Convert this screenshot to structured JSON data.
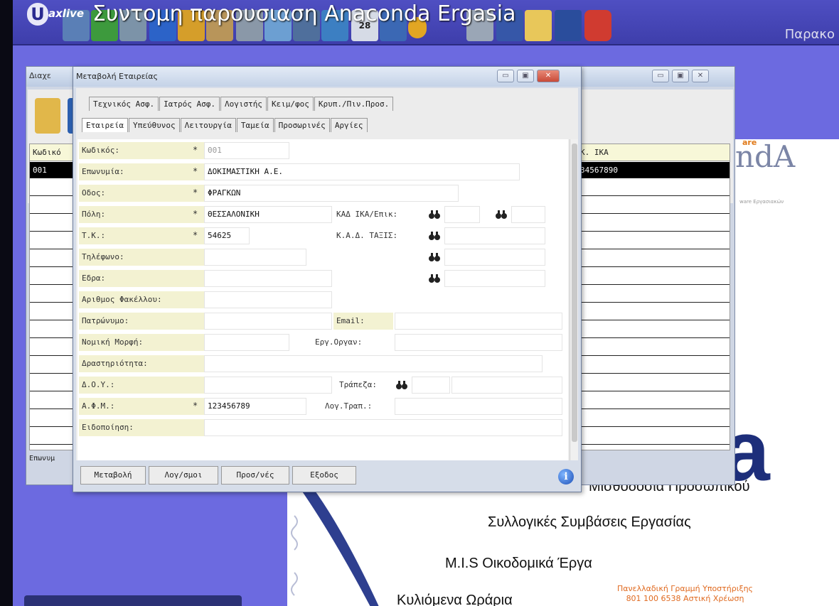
{
  "video": {
    "title": "Συντομη παρουσιαση Anaconda Ergasia",
    "brand": "axlive",
    "brand_initial": "U",
    "right_link": "Παρακο"
  },
  "toolbar": {
    "icons": [
      "tool-icon",
      "check-icon",
      "folder-icon",
      "sigma-icon",
      "bell-icon",
      "pyramid-icon",
      "clock-icon",
      "chart-icon",
      "phone-icon",
      "globe-icon",
      "calendar-icon",
      "chart-up-icon",
      "coin-icon",
      "database-icon",
      "user-icon",
      "notepad-icon",
      "person-icon",
      "power-icon"
    ],
    "calendar_day": "28"
  },
  "bg_window": {
    "title": "Διαχε",
    "columns": [
      "Κωδικό",
      "Κ. ΙΚΑ"
    ],
    "selected_row": {
      "code": "001",
      "ika": "34567890"
    },
    "bottom_label": "Επωνυμ"
  },
  "dialog": {
    "title": "Μεταβολή Εταιρείας",
    "tabs_row1": [
      "Τεχνικός Ασφ.",
      "Ιατρός Ασφ.",
      "Λογιστής",
      "Κειμ/φος",
      "Κρυπ./Πιν.Προσ."
    ],
    "tabs_row2": [
      "Εταιρεία",
      "Υπεύθυνος",
      "Λειτουργία",
      "Ταμεία",
      "Προσωρινές",
      "Αργίες"
    ],
    "fields": {
      "code_label": "Κωδικός:",
      "code_value": "001",
      "name_label": "Επωνυμία:",
      "name_value": "ΔΟΚΙΜΑΣΤΙΚΗ Α.Ε.",
      "street_label": "Οδος:",
      "street_value": "ΦΡΑΓΚΩΝ",
      "city_label": "Πόλη:",
      "city_value": "ΘΕΣΣΑΛΟΝΙΚΗ",
      "kad_ika_label": "ΚΑΔ ΙΚΑ/Επικ:",
      "tk_label": "Τ.Κ.:",
      "tk_value": "54625",
      "kad_taxis_label": "Κ.Α.Δ. ΤΑΞΙΣ:",
      "phone_label": "Τηλέφωνο:",
      "seat_label": "Εδρα:",
      "folder_label": "Αριθμος Φακέλλου:",
      "patronym_label": "Πατρώνυμο:",
      "email_label": "Email:",
      "legal_label": "Νομική Μορφή:",
      "employer_label": "Εργ.Οργαν:",
      "activity_label": "Δραστηριότητα:",
      "doy_label": "Δ.Ο.Υ.:",
      "bank_label": "Τράπεζα:",
      "afm_label": "Α.Φ.Μ.:",
      "afm_value": "123456789",
      "bank_acc_label": "Λογ.Τραπ.:",
      "notify_label": "Ειδοποίηση:",
      "required_mark": "*"
    },
    "buttons": [
      "Μεταβολή",
      "Λογ/σμοι",
      "Προσ/νές",
      "Εξοδος"
    ],
    "info": "i"
  },
  "ad": {
    "brand_top": "are",
    "brand": "ndA",
    "brand_sub": "ware Εργασιακών",
    "big_letter": "a",
    "lines": [
      "Μισθοδοσία Προσωπικού",
      "Συλλογικές Συμβάσεις Εργασίας",
      "M.I.S Οικοδομικά Έργα",
      "Κυλιόμενα Ωράρια"
    ],
    "support_1": "Πανελλαδική Γραμμή Υποστήριξης",
    "support_2": "801 100 6538 Αστική Χρέωση"
  }
}
